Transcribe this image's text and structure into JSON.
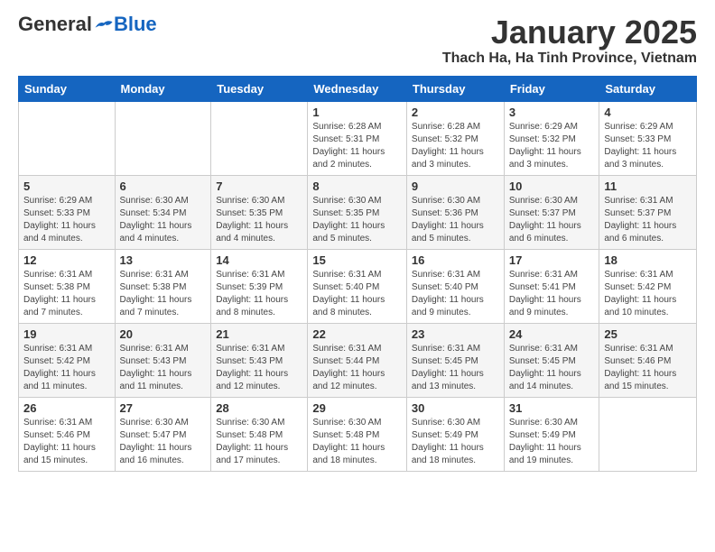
{
  "header": {
    "logo_general": "General",
    "logo_blue": "Blue",
    "month_title": "January 2025",
    "location": "Thach Ha, Ha Tinh Province, Vietnam"
  },
  "days_of_week": [
    "Sunday",
    "Monday",
    "Tuesday",
    "Wednesday",
    "Thursday",
    "Friday",
    "Saturday"
  ],
  "weeks": [
    [
      {
        "day": "",
        "info": ""
      },
      {
        "day": "",
        "info": ""
      },
      {
        "day": "",
        "info": ""
      },
      {
        "day": "1",
        "info": "Sunrise: 6:28 AM\nSunset: 5:31 PM\nDaylight: 11 hours\nand 2 minutes."
      },
      {
        "day": "2",
        "info": "Sunrise: 6:28 AM\nSunset: 5:32 PM\nDaylight: 11 hours\nand 3 minutes."
      },
      {
        "day": "3",
        "info": "Sunrise: 6:29 AM\nSunset: 5:32 PM\nDaylight: 11 hours\nand 3 minutes."
      },
      {
        "day": "4",
        "info": "Sunrise: 6:29 AM\nSunset: 5:33 PM\nDaylight: 11 hours\nand 3 minutes."
      }
    ],
    [
      {
        "day": "5",
        "info": "Sunrise: 6:29 AM\nSunset: 5:33 PM\nDaylight: 11 hours\nand 4 minutes."
      },
      {
        "day": "6",
        "info": "Sunrise: 6:30 AM\nSunset: 5:34 PM\nDaylight: 11 hours\nand 4 minutes."
      },
      {
        "day": "7",
        "info": "Sunrise: 6:30 AM\nSunset: 5:35 PM\nDaylight: 11 hours\nand 4 minutes."
      },
      {
        "day": "8",
        "info": "Sunrise: 6:30 AM\nSunset: 5:35 PM\nDaylight: 11 hours\nand 5 minutes."
      },
      {
        "day": "9",
        "info": "Sunrise: 6:30 AM\nSunset: 5:36 PM\nDaylight: 11 hours\nand 5 minutes."
      },
      {
        "day": "10",
        "info": "Sunrise: 6:30 AM\nSunset: 5:37 PM\nDaylight: 11 hours\nand 6 minutes."
      },
      {
        "day": "11",
        "info": "Sunrise: 6:31 AM\nSunset: 5:37 PM\nDaylight: 11 hours\nand 6 minutes."
      }
    ],
    [
      {
        "day": "12",
        "info": "Sunrise: 6:31 AM\nSunset: 5:38 PM\nDaylight: 11 hours\nand 7 minutes."
      },
      {
        "day": "13",
        "info": "Sunrise: 6:31 AM\nSunset: 5:38 PM\nDaylight: 11 hours\nand 7 minutes."
      },
      {
        "day": "14",
        "info": "Sunrise: 6:31 AM\nSunset: 5:39 PM\nDaylight: 11 hours\nand 8 minutes."
      },
      {
        "day": "15",
        "info": "Sunrise: 6:31 AM\nSunset: 5:40 PM\nDaylight: 11 hours\nand 8 minutes."
      },
      {
        "day": "16",
        "info": "Sunrise: 6:31 AM\nSunset: 5:40 PM\nDaylight: 11 hours\nand 9 minutes."
      },
      {
        "day": "17",
        "info": "Sunrise: 6:31 AM\nSunset: 5:41 PM\nDaylight: 11 hours\nand 9 minutes."
      },
      {
        "day": "18",
        "info": "Sunrise: 6:31 AM\nSunset: 5:42 PM\nDaylight: 11 hours\nand 10 minutes."
      }
    ],
    [
      {
        "day": "19",
        "info": "Sunrise: 6:31 AM\nSunset: 5:42 PM\nDaylight: 11 hours\nand 11 minutes."
      },
      {
        "day": "20",
        "info": "Sunrise: 6:31 AM\nSunset: 5:43 PM\nDaylight: 11 hours\nand 11 minutes."
      },
      {
        "day": "21",
        "info": "Sunrise: 6:31 AM\nSunset: 5:43 PM\nDaylight: 11 hours\nand 12 minutes."
      },
      {
        "day": "22",
        "info": "Sunrise: 6:31 AM\nSunset: 5:44 PM\nDaylight: 11 hours\nand 12 minutes."
      },
      {
        "day": "23",
        "info": "Sunrise: 6:31 AM\nSunset: 5:45 PM\nDaylight: 11 hours\nand 13 minutes."
      },
      {
        "day": "24",
        "info": "Sunrise: 6:31 AM\nSunset: 5:45 PM\nDaylight: 11 hours\nand 14 minutes."
      },
      {
        "day": "25",
        "info": "Sunrise: 6:31 AM\nSunset: 5:46 PM\nDaylight: 11 hours\nand 15 minutes."
      }
    ],
    [
      {
        "day": "26",
        "info": "Sunrise: 6:31 AM\nSunset: 5:46 PM\nDaylight: 11 hours\nand 15 minutes."
      },
      {
        "day": "27",
        "info": "Sunrise: 6:30 AM\nSunset: 5:47 PM\nDaylight: 11 hours\nand 16 minutes."
      },
      {
        "day": "28",
        "info": "Sunrise: 6:30 AM\nSunset: 5:48 PM\nDaylight: 11 hours\nand 17 minutes."
      },
      {
        "day": "29",
        "info": "Sunrise: 6:30 AM\nSunset: 5:48 PM\nDaylight: 11 hours\nand 18 minutes."
      },
      {
        "day": "30",
        "info": "Sunrise: 6:30 AM\nSunset: 5:49 PM\nDaylight: 11 hours\nand 18 minutes."
      },
      {
        "day": "31",
        "info": "Sunrise: 6:30 AM\nSunset: 5:49 PM\nDaylight: 11 hours\nand 19 minutes."
      },
      {
        "day": "",
        "info": ""
      }
    ]
  ]
}
